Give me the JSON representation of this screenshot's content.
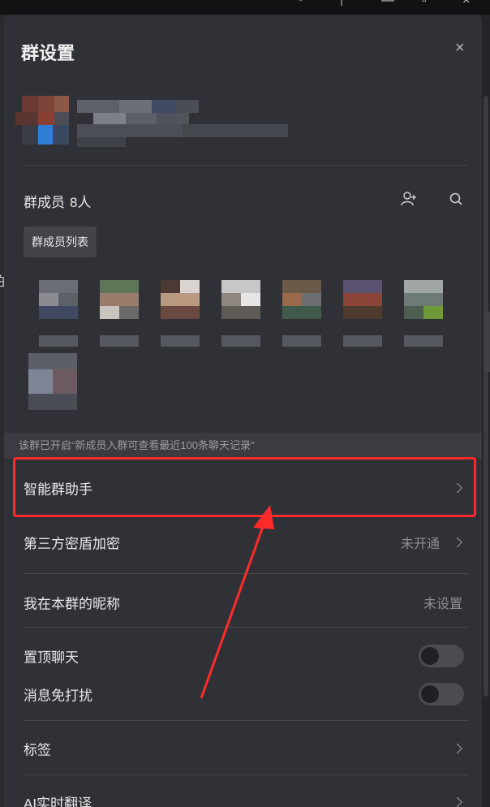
{
  "window": {
    "top_icons": [
      "clock-icon",
      "pin-icon",
      "minimize-icon",
      "restore-icon",
      "close-window-icon"
    ]
  },
  "panel": {
    "title": "群设置",
    "close_icon": "×"
  },
  "members": {
    "label": "群成员",
    "count": "8人",
    "add_icon": "add-member-icon",
    "search_icon": "search-icon",
    "tooltip": "群成员列表",
    "total_avatars_shown": 8
  },
  "notice": "该群已开启“新成员入群可查看最近100条聊天记录”",
  "rows": {
    "assistant": {
      "label": "智能群助手"
    },
    "encryption": {
      "label": "第三方密盾加密",
      "value": "未开通"
    },
    "nickname": {
      "label": "我在本群的昵称",
      "value": "未设置"
    },
    "pin": {
      "label": "置顶聊天",
      "state": "off"
    },
    "mute": {
      "label": "消息免打扰",
      "state": "off"
    },
    "tags": {
      "label": "标签"
    },
    "translate": {
      "label": "AI实时翻译"
    }
  },
  "annotation": {
    "highlight_color": "#ff2b2b"
  },
  "left_partial_char": "在"
}
